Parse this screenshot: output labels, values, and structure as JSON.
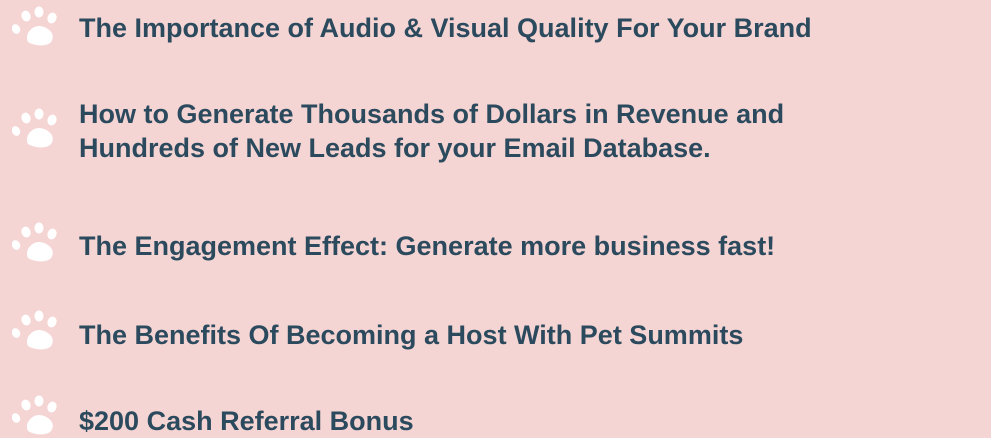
{
  "items": [
    {
      "icon": "paw-icon",
      "label": "The Importance of Audio & Visual Quality For Your Brand"
    },
    {
      "icon": "paw-icon",
      "label": "How to Generate Thousands of Dollars in Revenue and\nHundreds of New Leads for your Email Database."
    },
    {
      "icon": "paw-icon",
      "label": "The Engagement Effect: Generate more business fast!"
    },
    {
      "icon": "paw-icon",
      "label": "The Benefits Of Becoming a Host With Pet Summits"
    },
    {
      "icon": "paw-icon",
      "label": "$200 Cash Referral Bonus"
    }
  ],
  "colors": {
    "background": "#f5d5d3",
    "text": "#2c4a5e",
    "paw": "#ffffff"
  }
}
